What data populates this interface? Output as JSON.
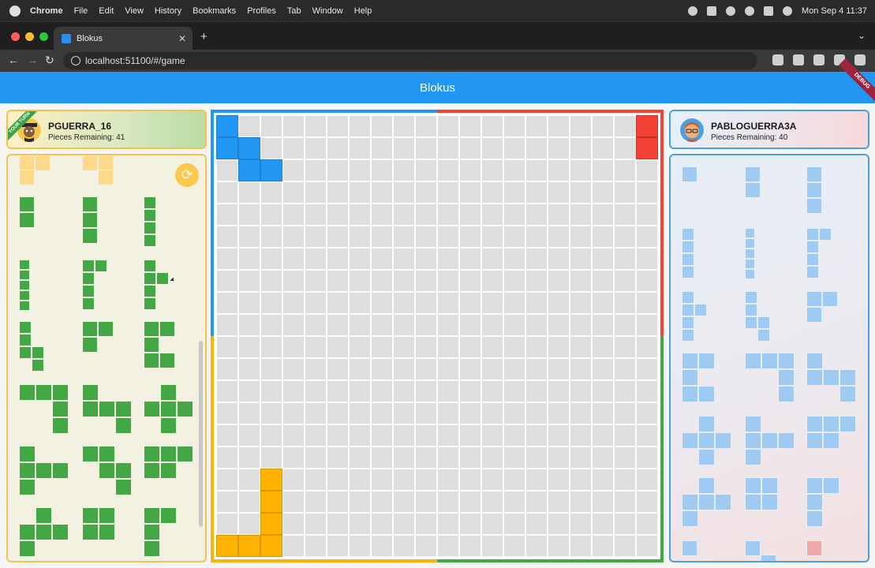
{
  "macos_menu": {
    "app_name": "Chrome",
    "items": [
      "File",
      "Edit",
      "View",
      "History",
      "Bookmarks",
      "Profiles",
      "Tab",
      "Window",
      "Help"
    ],
    "clock": "Mon Sep 4  11:37"
  },
  "browser": {
    "tab_title": "Blokus",
    "tab_close": "✕",
    "new_tab": "+",
    "tab_menu": "⌄",
    "url": "localhost:51100/#/game",
    "back": "←",
    "forward": "→",
    "reload": "↻"
  },
  "app": {
    "title": "Blokus",
    "debug_label": "DEBUG",
    "accent": "#2196f3"
  },
  "players": {
    "left": {
      "name": "PGUERRA_16",
      "pieces_remaining": "Pieces Remaining: 41",
      "turn_label": "YOUR TURN",
      "color": "#43a745"
    },
    "right": {
      "name": "PABLOGUERRA3A",
      "pieces_remaining": "Pieces Remaining: 40",
      "color": "#9fcbf3"
    }
  },
  "rotate_icon": "⟳",
  "board": {
    "size": 20,
    "colors": {
      "blue": "#2196f3",
      "red": "#f44336",
      "yellow": "#ffb300",
      "green": "#43a745"
    },
    "placed": [
      {
        "color": "blue",
        "cells": [
          [
            0,
            0
          ],
          [
            1,
            0
          ],
          [
            1,
            1
          ],
          [
            2,
            1
          ],
          [
            2,
            2
          ]
        ]
      },
      {
        "color": "red",
        "cells": [
          [
            0,
            19
          ],
          [
            1,
            19
          ]
        ]
      },
      {
        "color": "yellow",
        "cells": [
          [
            19,
            0
          ],
          [
            19,
            1
          ],
          [
            19,
            2
          ],
          [
            18,
            2
          ],
          [
            17,
            2
          ],
          [
            16,
            2
          ]
        ]
      }
    ]
  }
}
